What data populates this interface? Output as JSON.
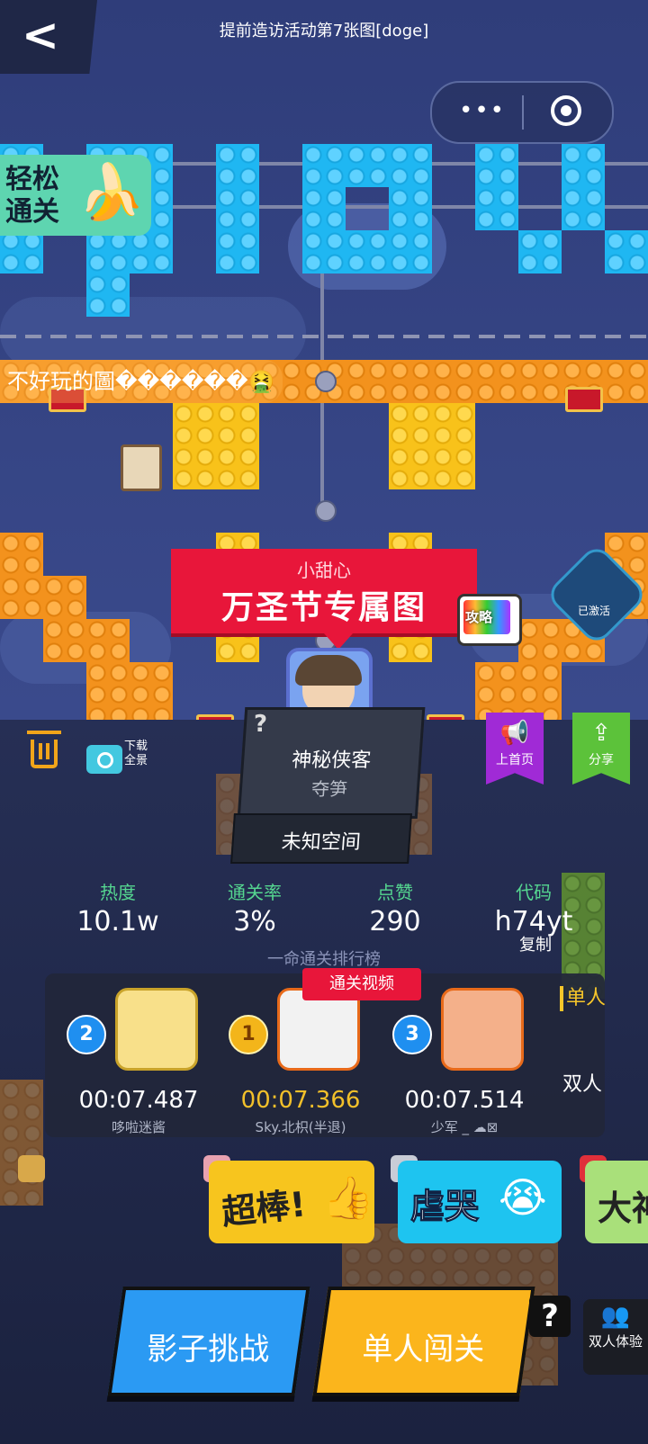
{
  "nav": {
    "back_glyph": "<",
    "more_glyph": "•••"
  },
  "easy_tag": {
    "text": "轻松通关",
    "icon": "banana-icon"
  },
  "danmaku": {
    "text": "不好玩的圖������🤮"
  },
  "level": {
    "author": "小甜心",
    "title": "万圣节专属图",
    "strategy_badge": "攻略",
    "activated_label": "已激活"
  },
  "creator": {
    "question": "?",
    "name": "神秘侠客",
    "sub": "夺笋",
    "space": "未知空间"
  },
  "tools": {
    "download_label": "下载全景",
    "homepage_label": "上首页",
    "share_label": "分享"
  },
  "stats": [
    {
      "label": "热度",
      "value": "10.1w"
    },
    {
      "label": "通关率",
      "value": "3%"
    },
    {
      "label": "点赞",
      "value": "290"
    },
    {
      "label": "代码",
      "value": "h74yt"
    }
  ],
  "copy_label": "复制",
  "leaderboard": {
    "title": "一命通关排行榜",
    "video_tag": "通关视频",
    "tabs": [
      "单人",
      "双人"
    ],
    "entries": [
      {
        "rank": "2",
        "time": "00:07.487",
        "name": "哆啦迷酱",
        "color": "#ffffff"
      },
      {
        "rank": "1",
        "time": "00:07.366",
        "name": "Sky.北枳(半退)",
        "color": "#f2c02a"
      },
      {
        "rank": "3",
        "time": "00:07.514",
        "name": "少军 _ ☁⊠",
        "color": "#ffffff"
      }
    ]
  },
  "comments": [
    {
      "text": "提前造访活动第7张图[doge]"
    },
    {
      "text": "超棒!",
      "bg": "#f7c51e"
    },
    {
      "text": "虐哭",
      "bg": "#1ec4f0"
    },
    {
      "text": "大神",
      "bg": "#a9e07a"
    }
  ],
  "actions": {
    "shadow": "影子挑战",
    "solo": "单人闯关",
    "help": "?",
    "duo": "双人体验"
  },
  "colors": {
    "accent_red": "#e8163a",
    "gold": "#f7c62a",
    "green": "#55d690",
    "purple": "#a02ad6",
    "share_green": "#5cc23a"
  }
}
